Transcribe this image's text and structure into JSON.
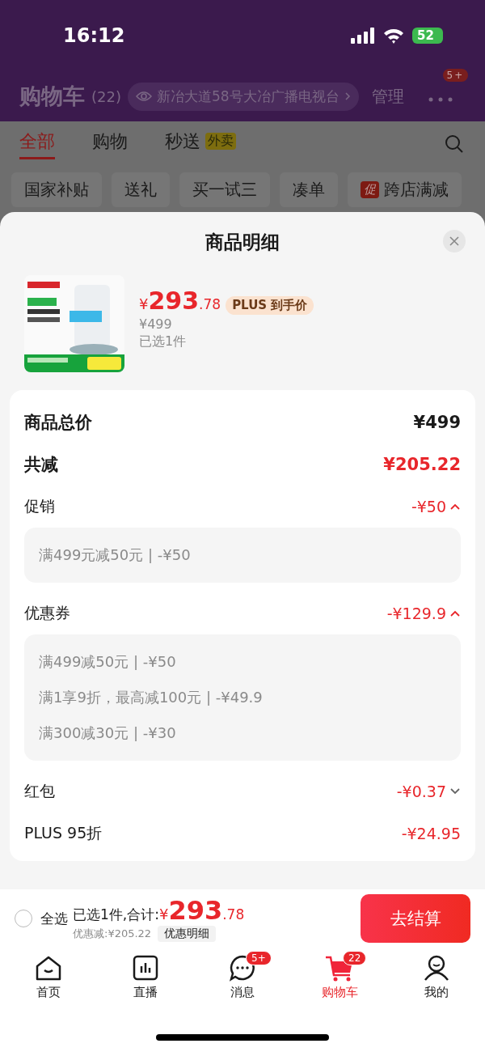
{
  "status_bar": {
    "time": "16:12",
    "battery": "52"
  },
  "header": {
    "title": "购物车",
    "count": "(22)",
    "address": "新冶大道58号大冶广播电视台",
    "manage": "管理",
    "more_badge": "5+"
  },
  "tabs": [
    {
      "label": "全部",
      "selected": true
    },
    {
      "label": "购物",
      "selected": false
    },
    {
      "label": "秒送",
      "selected": false,
      "tag": "外卖"
    }
  ],
  "chips": [
    {
      "label": "国家补贴"
    },
    {
      "label": "送礼"
    },
    {
      "label": "买一试三"
    },
    {
      "label": "凑单"
    },
    {
      "label": "跨店满减",
      "tag": "促"
    }
  ],
  "sheet": {
    "title": "商品明细",
    "product": {
      "price_symbol": "¥",
      "price_int": "293",
      "price_dec": ".78",
      "price_tag": "PLUS 到手价",
      "original_price": "¥499",
      "selected_count": "已选1件"
    },
    "rows": [
      {
        "kind": "total",
        "label": "商品总价",
        "value": "¥499"
      },
      {
        "kind": "reduction",
        "label": "共减",
        "value": "¥205.22"
      },
      {
        "kind": "group",
        "label": "促销",
        "value": "-¥50",
        "expanded": true,
        "details": [
          "满499元减50元 | -¥50"
        ]
      },
      {
        "kind": "group",
        "label": "优惠券",
        "value": "-¥129.9",
        "expanded": true,
        "details": [
          "满499减50元 | -¥50",
          "满1享9折，最高减100元 | -¥49.9",
          "满300减30元 | -¥30"
        ]
      },
      {
        "kind": "group",
        "label": "红包",
        "value": "-¥0.37",
        "expanded": false
      },
      {
        "kind": "plain",
        "label": "PLUS 95折",
        "value": "-¥24.95"
      }
    ]
  },
  "bottom_bar": {
    "select_all": {
      "label": "全选",
      "checked": false
    },
    "summary": "已选1件,合计:",
    "price_symbol": "¥",
    "price_int": "293",
    "price_dec": ".78",
    "discount": "优惠减:¥205.22",
    "detail_button": "优惠明细",
    "checkout": "去结算"
  },
  "nav": [
    {
      "kind": "home",
      "label": "首页",
      "selected": false
    },
    {
      "kind": "live",
      "label": "直播",
      "selected": false
    },
    {
      "kind": "message",
      "label": "消息",
      "selected": false,
      "badge": "5+"
    },
    {
      "kind": "cart",
      "label": "购物车",
      "selected": true,
      "badge": "22"
    },
    {
      "kind": "profile",
      "label": "我的",
      "selected": false
    }
  ]
}
